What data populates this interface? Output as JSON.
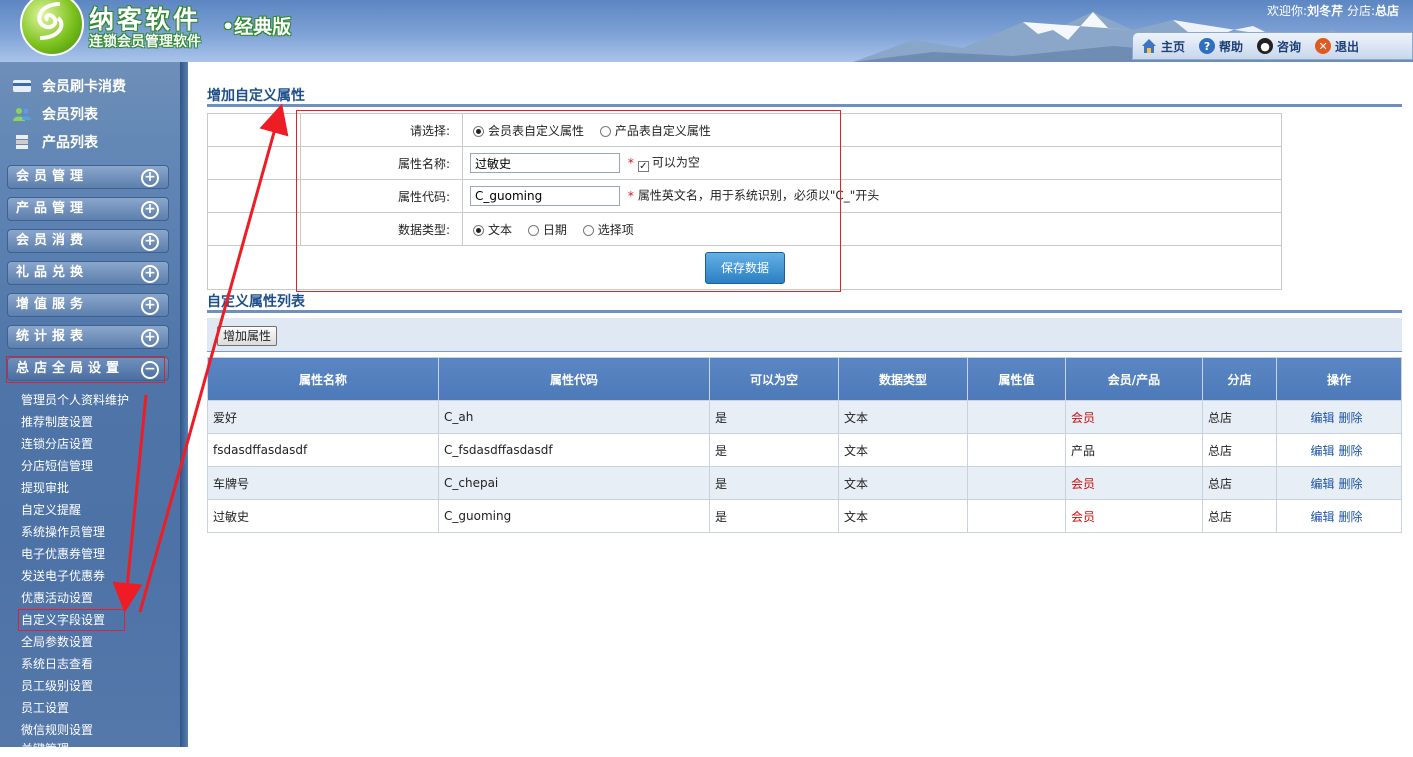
{
  "header": {
    "brand_main": "纳客软件",
    "brand_edition": "•经典版",
    "brand_sub": "连锁会员管理软件",
    "welcome_prefix": "欢迎你:",
    "user_name": "刘冬芹",
    "branch_label": "分店:",
    "branch_name": "总店",
    "nav": [
      {
        "label": "主页",
        "icon": "home-icon"
      },
      {
        "label": "帮助",
        "icon": "help-icon"
      },
      {
        "label": "咨询",
        "icon": "qq-icon"
      },
      {
        "label": "退出",
        "icon": "exit-icon"
      }
    ]
  },
  "sidebar": {
    "quick_links": [
      {
        "label": "会员刷卡消费",
        "icon": "card-icon"
      },
      {
        "label": "会员列表",
        "icon": "users-icon"
      },
      {
        "label": "产品列表",
        "icon": "database-icon"
      }
    ],
    "menus": [
      {
        "label": "会员管理",
        "toggle": "+"
      },
      {
        "label": "产品管理",
        "toggle": "+"
      },
      {
        "label": "会员消费",
        "toggle": "+"
      },
      {
        "label": "礼品兑换",
        "toggle": "+"
      },
      {
        "label": "增值服务",
        "toggle": "+"
      },
      {
        "label": "统计报表",
        "toggle": "+"
      },
      {
        "label": "总店全局设置",
        "toggle": "−"
      }
    ],
    "sub_items": [
      "管理员个人资料维护",
      "推荐制度设置",
      "连锁分店设置",
      "分店短信管理",
      "提现审批",
      "自定义提醒",
      "系统操作员管理",
      "电子优惠券管理",
      "发送电子优惠券",
      "优惠活动设置",
      "自定义字段设置",
      "全局参数设置",
      "系统日志查看",
      "员工级别设置",
      "员工设置",
      "微信规则设置",
      "关键管理"
    ]
  },
  "form": {
    "title": "增加自定义属性",
    "select_label": "请选择:",
    "select_options": [
      "会员表自定义属性",
      "产品表自定义属性"
    ],
    "name_label": "属性名称:",
    "name_value": "过敏史",
    "nullable_label": "可以为空",
    "code_label": "属性代码:",
    "code_value": "C_guoming",
    "code_hint": "属性英文名，用于系统识别，必须以\"C_\"开头",
    "type_label": "数据类型:",
    "type_options": [
      "文本",
      "日期",
      "选择项"
    ],
    "required_mark": "*",
    "save_label": "保存数据"
  },
  "list": {
    "title": "自定义属性列表",
    "add_label": "增加属性",
    "columns": [
      "属性名称",
      "属性代码",
      "可以为空",
      "数据类型",
      "属性值",
      "会员/产品",
      "分店",
      "操作"
    ],
    "edit_label": "编辑",
    "delete_label": "删除",
    "rows": [
      {
        "name": "爱好",
        "code": "C_ah",
        "nullable": "是",
        "type": "文本",
        "value": "",
        "target": "会员",
        "branch": "总店"
      },
      {
        "name": "fsdasdffasdasdf",
        "code": "C_fsdasdffasdasdf",
        "nullable": "是",
        "type": "文本",
        "value": "",
        "target": "产品",
        "branch": "总店"
      },
      {
        "name": "车牌号",
        "code": "C_chepai",
        "nullable": "是",
        "type": "文本",
        "value": "",
        "target": "会员",
        "branch": "总店"
      },
      {
        "name": "过敏史",
        "code": "C_guoming",
        "nullable": "是",
        "type": "文本",
        "value": "",
        "target": "会员",
        "branch": "总店"
      }
    ]
  },
  "colors": {
    "accent_blue": "#4c79b8",
    "member_red": "#c81010",
    "annotation_red": "#e3202b"
  }
}
